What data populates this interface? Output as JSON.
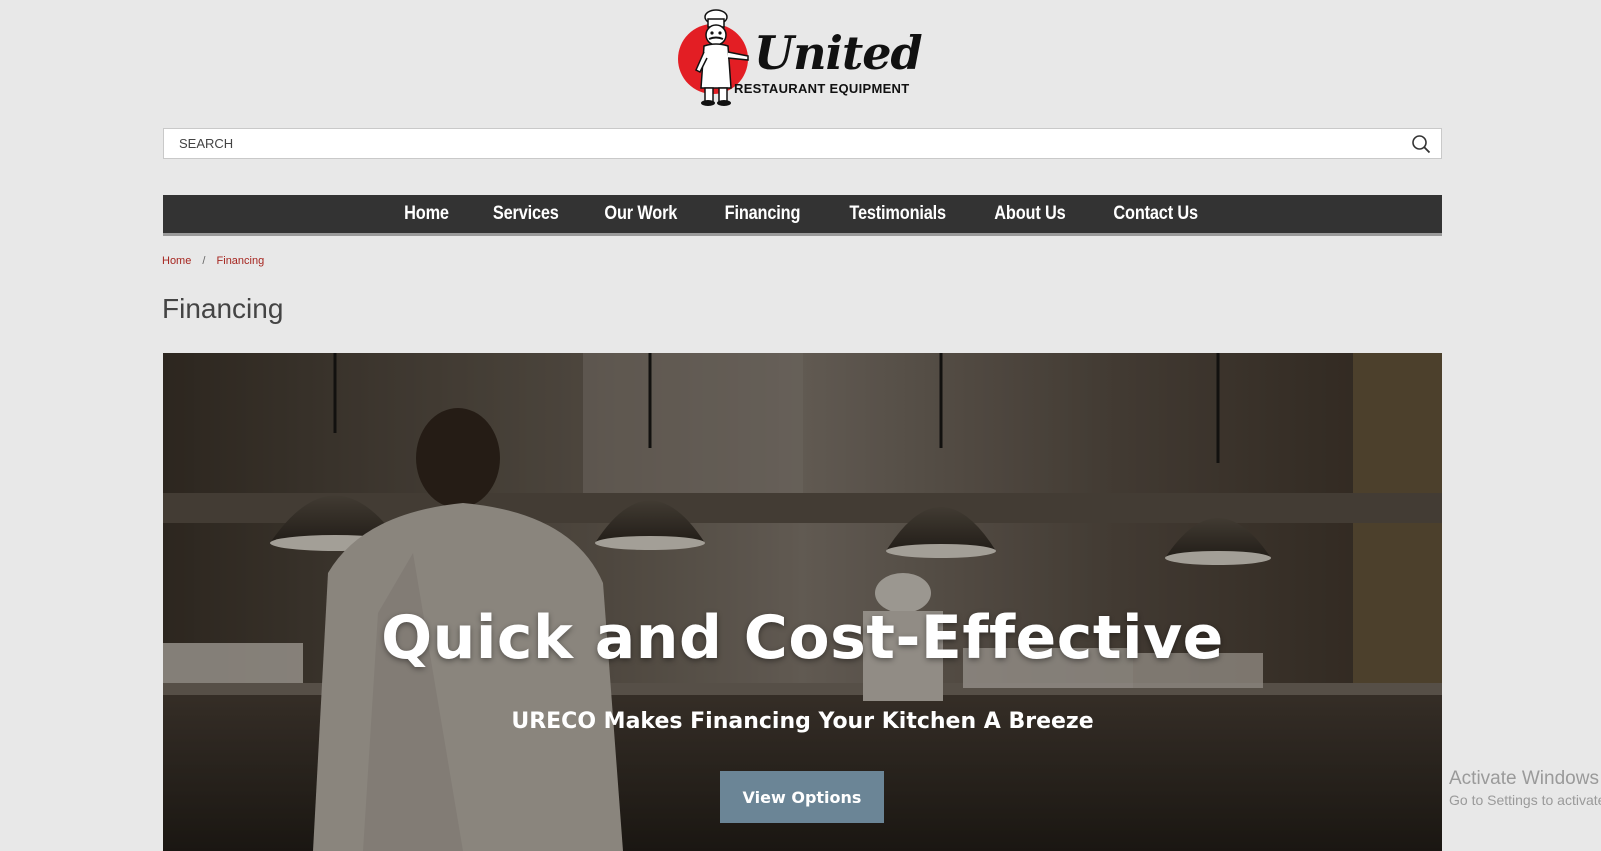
{
  "logo": {
    "title": "United",
    "subtitle": "RESTAURANT EQUIPMENT"
  },
  "search": {
    "placeholder": "SEARCH",
    "icon": "search-icon"
  },
  "nav": {
    "items": [
      "Home",
      "Services",
      "Our Work",
      "Financing",
      "Testimonials",
      "About Us",
      "Contact Us"
    ]
  },
  "breadcrumb": {
    "items": [
      "Home",
      "Financing"
    ],
    "separator": "/"
  },
  "page": {
    "title": "Financing"
  },
  "hero": {
    "title": "Quick and Cost-Effective",
    "subtitle": "URECO Makes Financing Your Kitchen A Breeze",
    "button_label": "View Options"
  },
  "watermark": {
    "line1": "Activate Windows",
    "line2": "Go to Settings to activate Windows."
  },
  "colors": {
    "page_bg": "#e8e8e8",
    "nav_bg": "#333333",
    "breadcrumb_link": "#a62620",
    "logo_red": "#e31e24",
    "hero_button": "#6b8596"
  }
}
